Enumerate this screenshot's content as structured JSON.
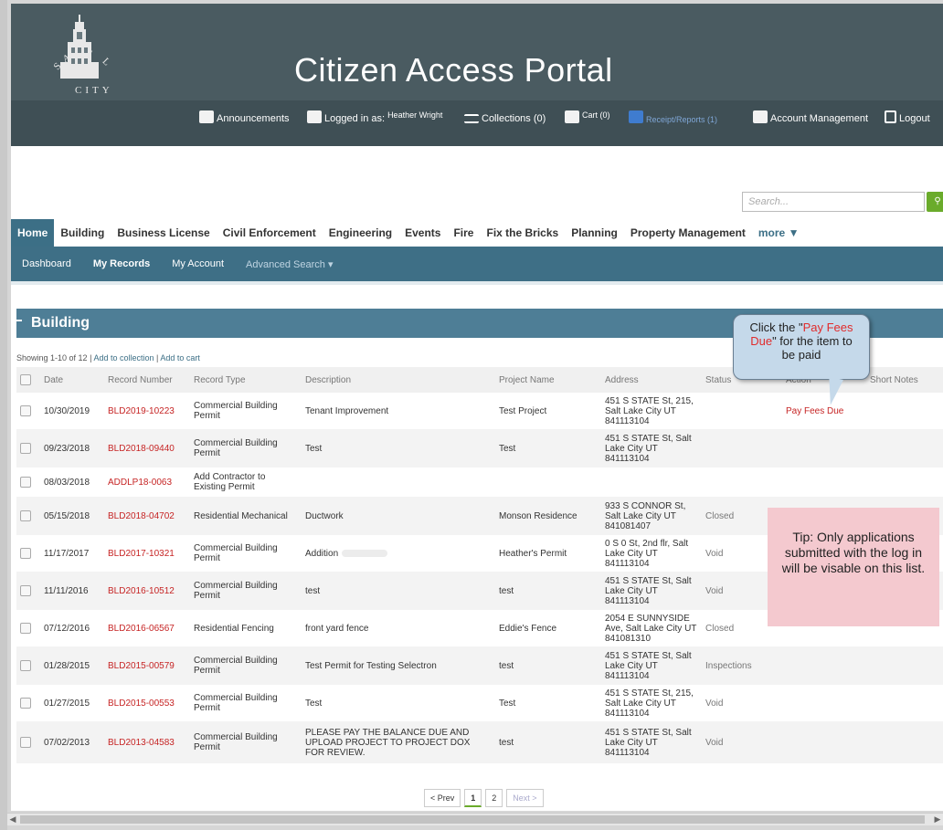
{
  "header": {
    "site_title": "Citizen Access Portal",
    "logo_text": "SALT LAKE CITY",
    "links": {
      "announcements": "Announcements",
      "logged_in_as": "Logged in as:",
      "user_name": "Heather Wright",
      "collections": "Collections (0)",
      "cart": "Cart (0)",
      "receipt_reports": "Receipt/Reports (1)",
      "account_management": "Account Management",
      "logout": "Logout"
    }
  },
  "search": {
    "placeholder": "Search..."
  },
  "main_nav": [
    "Home",
    "Building",
    "Business License",
    "Civil Enforcement",
    "Engineering",
    "Events",
    "Fire",
    "Fix the Bricks",
    "Planning",
    "Property Management",
    "more ▼"
  ],
  "sub_nav": [
    "Dashboard",
    "My Records",
    "My Account",
    "Advanced Search ▾"
  ],
  "section": {
    "title": "Building",
    "showing": "Showing 1-10 of 12",
    "sep": "|",
    "add_collection": "Add to collection",
    "add_cart": "Add to cart"
  },
  "table": {
    "headers": [
      "Date",
      "Record Number",
      "Record Type",
      "Description",
      "Project Name",
      "Address",
      "Status",
      "Action",
      "Short Notes"
    ],
    "rows": [
      {
        "date": "10/30/2019",
        "record": "BLD2019-10223",
        "type": "Commercial Building Permit",
        "desc": "Tenant Improvement",
        "project": "Test Project",
        "address": "451 S STATE St, 215, Salt Lake City UT 841113104",
        "status": "",
        "action": "Pay Fees Due"
      },
      {
        "date": "09/23/2018",
        "record": "BLD2018-09440",
        "type": "Commercial Building Permit",
        "desc": "Test",
        "project": "Test",
        "address": "451 S STATE St, Salt Lake City UT 841113104",
        "status": "",
        "action": ""
      },
      {
        "date": "08/03/2018",
        "record": "ADDLP18-0063",
        "type": "Add Contractor to Existing Permit",
        "desc": "",
        "project": "",
        "address": "",
        "status": "",
        "action": ""
      },
      {
        "date": "05/15/2018",
        "record": "BLD2018-04702",
        "type": "Residential Mechanical",
        "desc": "Ductwork",
        "project": "Monson Residence",
        "address": "933 S CONNOR St, Salt Lake City UT 841081407",
        "status": "Closed",
        "action": ""
      },
      {
        "date": "11/17/2017",
        "record": "BLD2017-10321",
        "type": "Commercial Building Permit",
        "desc": "Addition",
        "project": "Heather's Permit",
        "address": "0 S 0 St, 2nd flr, Salt Lake City UT 841113104",
        "status": "Void",
        "action": ""
      },
      {
        "date": "11/11/2016",
        "record": "BLD2016-10512",
        "type": "Commercial Building Permit",
        "desc": "test",
        "project": "test",
        "address": "451 S STATE St, Salt Lake City UT 841113104",
        "status": "Void",
        "action": ""
      },
      {
        "date": "07/12/2016",
        "record": "BLD2016-06567",
        "type": "Residential Fencing",
        "desc": "front yard fence",
        "project": "Eddie's Fence",
        "address": "2054 E SUNNYSIDE Ave, Salt Lake City UT 841081310",
        "status": "Closed",
        "action": ""
      },
      {
        "date": "01/28/2015",
        "record": "BLD2015-00579",
        "type": "Commercial Building Permit",
        "desc": "Test Permit for Testing Selectron",
        "project": "test",
        "address": "451 S STATE St, Salt Lake City UT 841113104",
        "status": "Inspections",
        "action": ""
      },
      {
        "date": "01/27/2015",
        "record": "BLD2015-00553",
        "type": "Commercial Building Permit",
        "desc": "Test",
        "project": "Test",
        "address": "451 S STATE St, 215, Salt Lake City UT 841113104",
        "status": "Void",
        "action": ""
      },
      {
        "date": "07/02/2013",
        "record": "BLD2013-04583",
        "type": "Commercial Building Permit",
        "desc": "PLEASE PAY THE BALANCE DUE AND UPLOAD PROJECT TO PROJECT DOX FOR REVIEW.",
        "project": "test",
        "address": "451 S STATE St, Salt Lake City UT 841113104",
        "status": "Void",
        "action": ""
      }
    ]
  },
  "callout": {
    "pre": "Click the \"",
    "highlight": "Pay Fees Due",
    "post": "\" for the item to be paid"
  },
  "tip": "Tip: Only applications submitted with the log in will be visable on this list.",
  "pager": {
    "prev": "< Prev",
    "pages": [
      "1",
      "2"
    ],
    "next": "Next >"
  },
  "colors": {
    "header": "#4a5b61",
    "accent": "#3e6f86",
    "record_red": "#c62424",
    "tip_bg": "#f4c9cf",
    "bubble_bg": "#c5d9ea"
  }
}
